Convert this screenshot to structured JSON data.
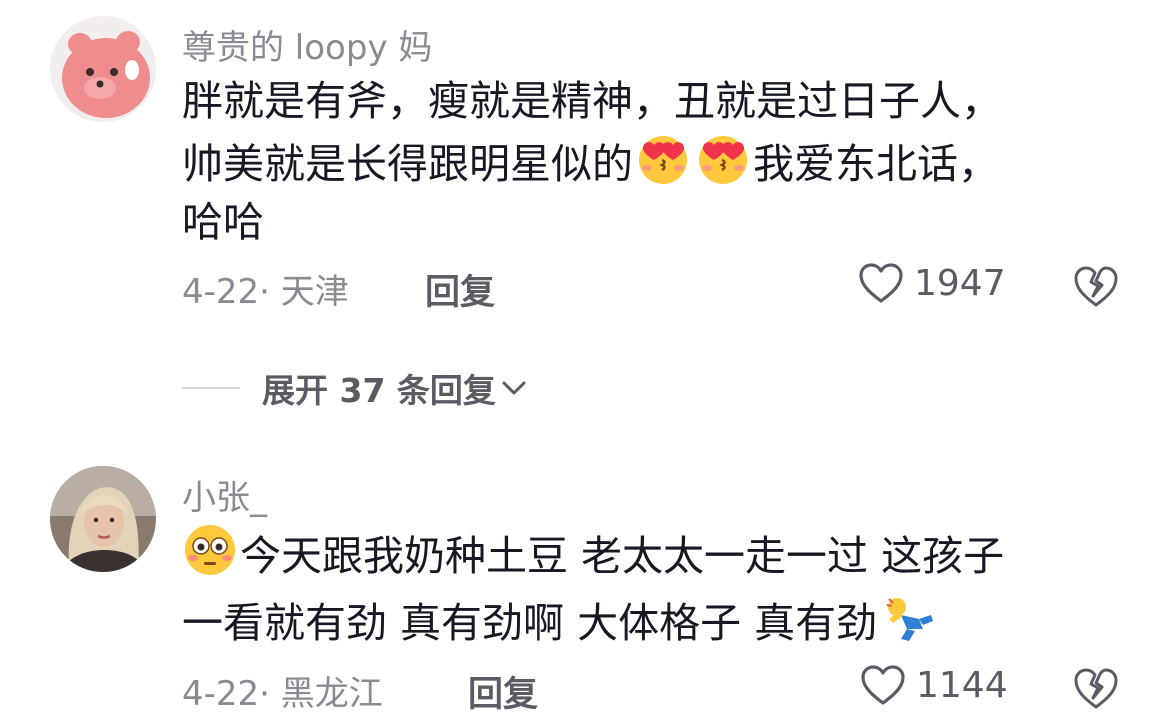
{
  "comments": [
    {
      "username": "尊贵的 loopy 妈",
      "content_line1": "胖就是有斧，瘦就是精神，丑就是过日子人，",
      "content_line2_a": "帅美就是长得跟明星似的",
      "content_line2_b": "我爱东北话，",
      "content_line3": "哈哈",
      "date_location": "4-22· 天津",
      "reply_label": "回复",
      "likes": "1947",
      "emojis": [
        "heart-eyes-kiss-emoji",
        "heart-eyes-kiss-emoji"
      ]
    },
    {
      "username": "小张_",
      "content_line1": "今天跟我奶种土豆 老太太一走一过 这孩子",
      "content_line2": "一看就有劲 真有劲啊 大体格子 真有劲",
      "date_location": "4-22· 黑龙江",
      "reply_label": "回复",
      "likes": "1144",
      "emojis": [
        "flushed-face-emoji",
        "tumbling-person-emoji"
      ]
    }
  ],
  "expand_replies": {
    "label": "展开 37 条回复"
  },
  "colors": {
    "text_primary": "#161823",
    "text_secondary": "#8a8b91",
    "action": "#5b5c63"
  }
}
